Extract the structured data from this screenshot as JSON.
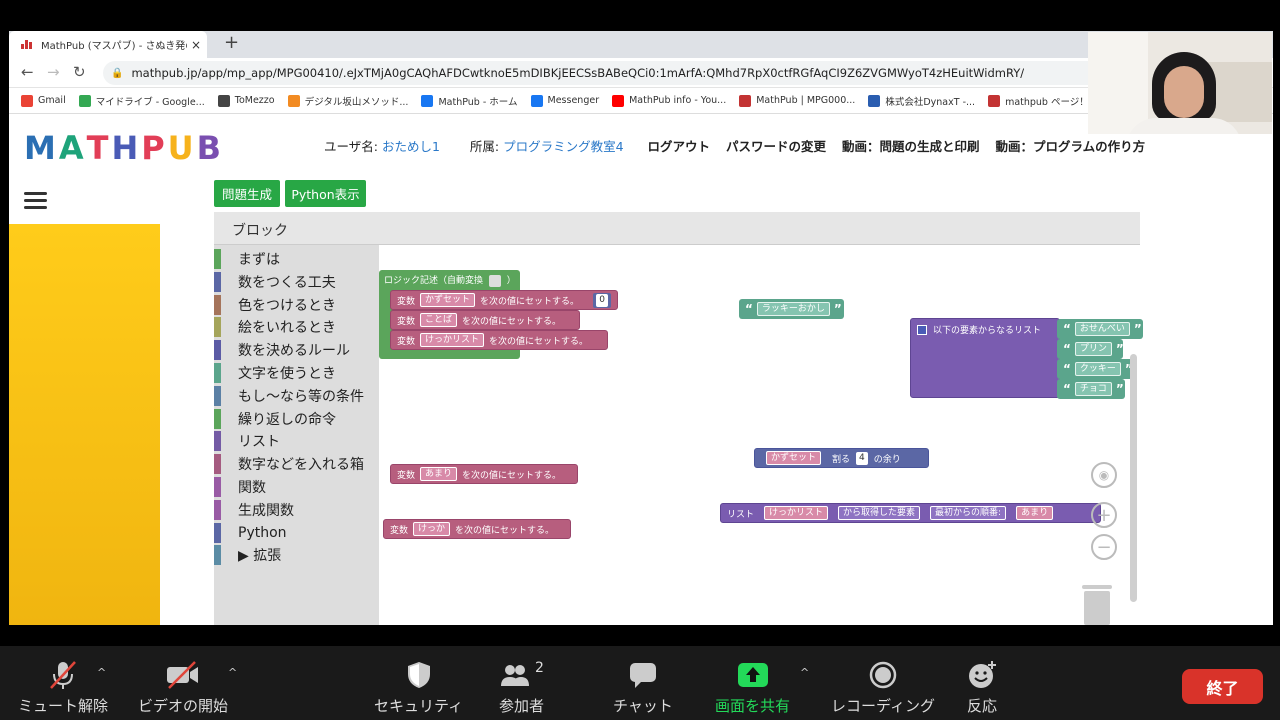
{
  "browser": {
    "tab_title": "MathPub (マスパブ) - さぬき発のAI...",
    "tab_close": "×",
    "new_tab": "+",
    "url": "mathpub.jp/app/mp_app/MPG00410/.eJxTMjA0gCAQhAFDCwtknoE5mDIBKjEECSsBABeQCi0:1mArfA:QMhd7RpX0ctfRGfAqCI9Z6ZVGMWyoT4zHEuitWidmRY/",
    "bookmarks": [
      {
        "label": "Gmail",
        "color": "#ea4335"
      },
      {
        "label": "マイドライブ - Google...",
        "color": "#34a853"
      },
      {
        "label": "ToMezzo",
        "color": "#444444"
      },
      {
        "label": "デジタル坂山メソッド...",
        "color": "#f28b22"
      },
      {
        "label": "MathPub - ホーム",
        "color": "#1877f2"
      },
      {
        "label": "Messenger",
        "color": "#1877f2"
      },
      {
        "label": "MathPub info - You...",
        "color": "#ff0000"
      },
      {
        "label": "MathPub | MPG000...",
        "color": "#c33333"
      },
      {
        "label": "株式会社DynaxT -...",
        "color": "#2a5db0"
      },
      {
        "label": "mathpub ページ！",
        "color": "#c33333"
      }
    ]
  },
  "header": {
    "user_label": "ユーザ名: ",
    "user_name": "おためし1",
    "org_label": "所属: ",
    "org_name": "プログラミング教室4",
    "logout": "ログアウト",
    "change_password": "パスワードの変更",
    "video1": "動画：問題の生成と印刷",
    "video2": "動画：プログラムの作り方"
  },
  "logo_letters": [
    {
      "ch": "M",
      "color": "#2b6fb3"
    },
    {
      "ch": "A",
      "color": "#1ea37a"
    },
    {
      "ch": "T",
      "color": "#e23e57"
    },
    {
      "ch": "H",
      "color": "#4a5bb6"
    },
    {
      "ch": "P",
      "color": "#e23e57"
    },
    {
      "ch": "U",
      "color": "#f6b21c"
    },
    {
      "ch": "B",
      "color": "#7a4fb0"
    }
  ],
  "buttons": {
    "generate": "問題生成",
    "python_view": "Python表示"
  },
  "blocks_header": "ブロック",
  "categories": [
    {
      "label": "まずは",
      "color": "#5ba55b"
    },
    {
      "label": "数をつくる工夫",
      "color": "#5b67a5"
    },
    {
      "label": "色をつけるとき",
      "color": "#a5745b"
    },
    {
      "label": "絵をいれるとき",
      "color": "#a5a55b"
    },
    {
      "label": "数を決めるルール",
      "color": "#5b5ba5"
    },
    {
      "label": "文字を使うとき",
      "color": "#5ba58c"
    },
    {
      "label": "もし～なら等の条件",
      "color": "#5b80a5"
    },
    {
      "label": "繰り返しの命令",
      "color": "#5ba55b"
    },
    {
      "label": "リスト",
      "color": "#745ba5"
    },
    {
      "label": "数字などを入れる箱",
      "color": "#a55b80"
    },
    {
      "label": "関数",
      "color": "#995ba5"
    },
    {
      "label": "生成関数",
      "color": "#995ba5"
    },
    {
      "label": "Python",
      "color": "#5b67a5"
    },
    {
      "label": "▶ 拡張",
      "color": "#5b8ca5"
    }
  ],
  "blocks": {
    "logic_label": "ロジック記述（自動変換",
    "logic_close": "）",
    "var_word": "変数",
    "set_suffix": "を次の値にセットする。",
    "v1": "かずセット",
    "v1_value": "0",
    "v2": "ことば",
    "v3": "けっかリスト",
    "v4": "あまり",
    "v5": "けっか",
    "lucky": "ラッキーおかし",
    "list_label": "以下の要素からなるリスト",
    "list_items": [
      "おせんべい",
      "プリン",
      "クッキー",
      "チョコ"
    ],
    "mod_var": "かずセット",
    "mod_word": "割る",
    "mod_num": "4",
    "mod_suffix": "の余り",
    "get_list": "リスト",
    "get_var": "けっかリスト",
    "get_op": "から取得した要素",
    "get_from": "最初からの順番:",
    "get_idx": "あまり"
  },
  "zoom": {
    "mute": "ミュート解除",
    "video": "ビデオの開始",
    "security": "セキュリティ",
    "participants": "参加者",
    "participants_count": "2",
    "chat": "チャット",
    "share": "画面を共有",
    "record": "レコーディング",
    "react": "反応",
    "end": "終了"
  }
}
